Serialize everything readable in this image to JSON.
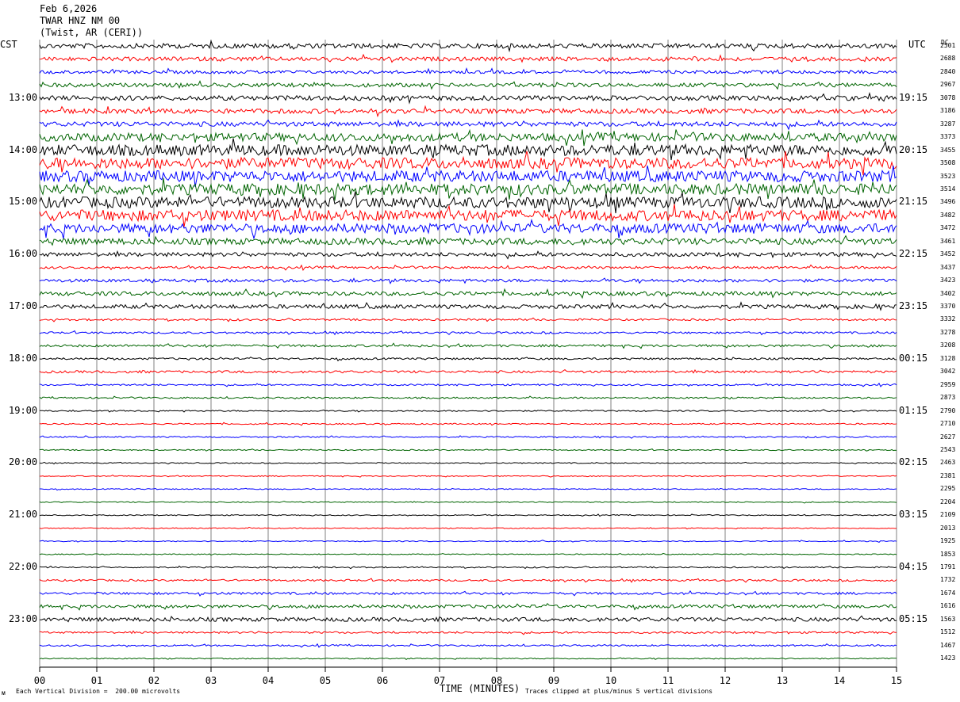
{
  "header": {
    "date": "Feb 6,2026",
    "station": "TWAR HNZ NM 00",
    "location": "(Twist, AR (CERI))"
  },
  "left_timezone": "CST",
  "right_timezone": "UTC",
  "dc_label": "DC",
  "footer": {
    "left_mark": "ᴍ",
    "scale_note": "Each Vertical Division =  200.00 microvolts",
    "xlabel": "TIME (MINUTES)",
    "clip_note": "Traces clipped at plus/minus 5 vertical divisions"
  },
  "colors": {
    "black": "#000000",
    "red": "#ff0000",
    "blue": "#0000ff",
    "green": "#006400",
    "grid": "#808080"
  },
  "chart_data": {
    "type": "line",
    "title": "",
    "xlabel": "TIME (MINUTES)",
    "ylabel": "",
    "xlim": [
      0,
      15
    ],
    "xticks": [
      "00",
      "01",
      "02",
      "03",
      "04",
      "05",
      "06",
      "07",
      "08",
      "09",
      "10",
      "11",
      "12",
      "13",
      "14",
      "15"
    ],
    "trace_minutes": 15,
    "color_cycle": [
      "black",
      "red",
      "blue",
      "green"
    ],
    "left_hour_labels": [
      {
        "trace": 4,
        "label": "13:00"
      },
      {
        "trace": 8,
        "label": "14:00"
      },
      {
        "trace": 12,
        "label": "15:00"
      },
      {
        "trace": 16,
        "label": "16:00"
      },
      {
        "trace": 20,
        "label": "17:00"
      },
      {
        "trace": 24,
        "label": "18:00"
      },
      {
        "trace": 28,
        "label": "19:00"
      },
      {
        "trace": 32,
        "label": "20:00"
      },
      {
        "trace": 36,
        "label": "21:00"
      },
      {
        "trace": 40,
        "label": "22:00"
      },
      {
        "trace": 44,
        "label": "23:00"
      }
    ],
    "right_hour_labels": [
      {
        "trace": 4,
        "label": "19:15"
      },
      {
        "trace": 8,
        "label": "20:15"
      },
      {
        "trace": 12,
        "label": "21:15"
      },
      {
        "trace": 16,
        "label": "22:15"
      },
      {
        "trace": 20,
        "label": "23:15"
      },
      {
        "trace": 24,
        "label": "00:15"
      },
      {
        "trace": 28,
        "label": "01:15"
      },
      {
        "trace": 32,
        "label": "02:15"
      },
      {
        "trace": 36,
        "label": "03:15"
      },
      {
        "trace": 40,
        "label": "04:15"
      },
      {
        "trace": 44,
        "label": "05:15"
      }
    ],
    "dc_offsets": [
      "2501",
      "2688",
      "2840",
      "2967",
      "3078",
      "3186",
      "3287",
      "3373",
      "3455",
      "3508",
      "3523",
      "3514",
      "3496",
      "3482",
      "3472",
      "3461",
      "3452",
      "3437",
      "3423",
      "3402",
      "3370",
      "3332",
      "3278",
      "3208",
      "3128",
      "3042",
      "2959",
      "2873",
      "2790",
      "2710",
      "2627",
      "2543",
      "2463",
      "2381",
      "2295",
      "2204",
      "2109",
      "2013",
      "1925",
      "1853",
      "1791",
      "1732",
      "1674",
      "1616",
      "1563",
      "1512",
      "1467",
      "1423"
    ],
    "trace_noise_level": [
      3,
      2.5,
      2,
      2.5,
      3,
      3,
      3,
      5,
      7,
      7,
      7,
      7,
      7,
      7,
      6,
      4,
      2.5,
      1.5,
      2,
      2.5,
      2.5,
      1.2,
      1.2,
      1.5,
      1.2,
      1.5,
      1,
      1,
      0.8,
      0.8,
      0.8,
      0.7,
      0.6,
      0.6,
      0.6,
      0.6,
      0.6,
      0.6,
      0.6,
      0.6,
      0.8,
      1.2,
      1.5,
      2,
      2.5,
      1.2,
      1,
      0.7
    ]
  }
}
